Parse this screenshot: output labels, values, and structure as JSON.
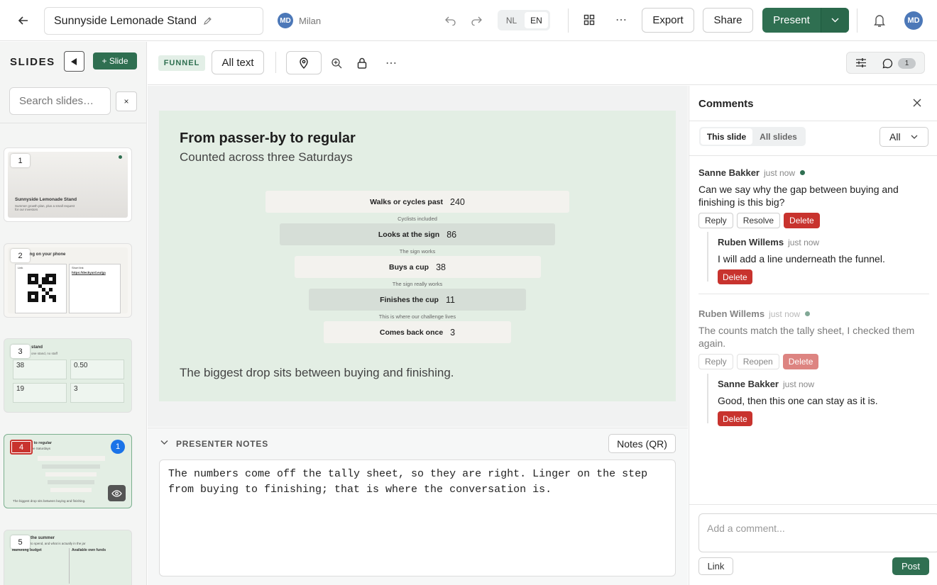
{
  "app": {
    "title": "Sunnyside Lemonade Stand",
    "user_initials": "MD",
    "collaborator_name": "Milan",
    "collaborator_initials": "MD",
    "lang_options": [
      "NL",
      "EN"
    ],
    "lang_selected": "EN",
    "export_label": "Export",
    "share_label": "Share",
    "present_label": "Present"
  },
  "sidebar": {
    "heading": "SLIDES",
    "add_label": "+ Slide",
    "search_placeholder": "Search slides…",
    "clear_label": "×",
    "thumbs": [
      {
        "num": "1",
        "title": "Sunnyside Lemonade Stand",
        "line": "Summer growth plan, plus a small request for our investors"
      },
      {
        "num": "2",
        "title": "along on your phone",
        "link": "https://deckyard.eu/ga",
        "label": "Link",
        "label2": "Short link"
      },
      {
        "num": "3",
        "title": "stand",
        "sub": "one stand, no staff",
        "cells": [
          "38",
          "0.50",
          "19",
          "3"
        ]
      },
      {
        "num": "4",
        "title": "y to regular",
        "sub": "ree Saturdays",
        "foot": "The biggest drop sits between buying and finishing.",
        "badge": "1"
      },
      {
        "num": "5",
        "title": "the summer",
        "sub": "to spend, and what is actually in the jar",
        "col1": "Marketing budget",
        "col2": "Available own funds"
      }
    ]
  },
  "toolbar": {
    "tag": "FUNNEL",
    "all_text": "All text"
  },
  "slide": {
    "title": "From passer-by to regular",
    "subtitle": "Counted across three Saturdays",
    "footer": "The biggest drop sits between buying and finishing.",
    "steps": [
      {
        "label": "Walks or cycles past",
        "value": 240,
        "note": "Cyclists included"
      },
      {
        "label": "Looks at the sign",
        "value": 86,
        "note": "The sign works"
      },
      {
        "label": "Buys a cup",
        "value": 38,
        "note": "The sign really works"
      },
      {
        "label": "Finishes the cup",
        "value": 11,
        "note": "This is where our challenge lives"
      },
      {
        "label": "Comes back once",
        "value": 3,
        "note": ""
      }
    ]
  },
  "notes": {
    "heading": "PRESENTER NOTES",
    "qr_label": "Notes (QR)",
    "body": "The numbers come off the tally sheet, so they are right. Linger on the step from buying to finishing; that is where the conversation is."
  },
  "panel": {
    "title": "Comments",
    "comment_count": "1",
    "tab_this": "This slide",
    "tab_all": "All slides",
    "filter": "All",
    "composer_placeholder": "Add a comment...",
    "link_label": "Link",
    "post_label": "Post",
    "threads": [
      {
        "author": "Sanne Bakker",
        "time": "just now",
        "status_color": "#2f6f51",
        "body": "Can we say why the gap between buying and finishing is this big?",
        "actions": [
          "Reply",
          "Resolve"
        ],
        "delete": "Delete",
        "reply": {
          "author": "Ruben Willems",
          "time": "just now",
          "body": "I will add a line underneath the funnel.",
          "delete": "Delete"
        }
      },
      {
        "author": "Ruben Willems",
        "time": "just now",
        "status_color": "#2f6f51",
        "body": "The counts match the tally sheet, I checked them again.",
        "actions": [
          "Reply",
          "Reopen"
        ],
        "delete": "Delete",
        "reply": {
          "author": "Sanne Bakker",
          "time": "just now",
          "body": "Good, then this one can stay as it is.",
          "delete": "Delete"
        }
      }
    ]
  },
  "colors": {
    "accent": "#2f6f51",
    "danger": "#c8332e",
    "slide_bg": "#e3eee4"
  }
}
